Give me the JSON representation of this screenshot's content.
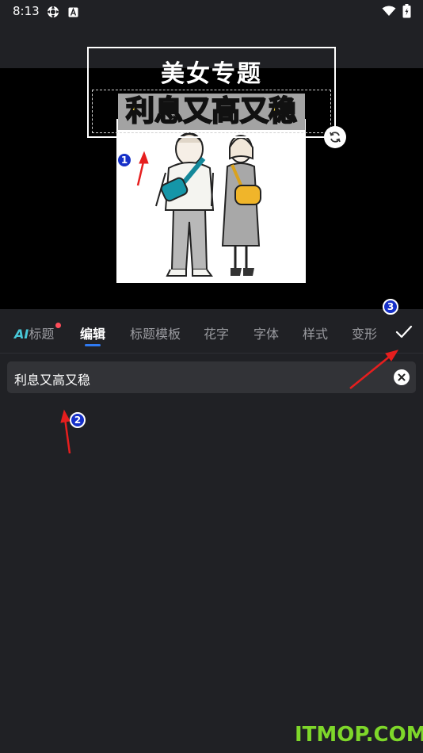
{
  "status_bar": {
    "time": "8:13",
    "icons": [
      "settings-icon",
      "a-icon",
      "wifi-icon",
      "battery-icon"
    ]
  },
  "preview": {
    "title_line1": "美女专题",
    "title_line2": "利息又高又稳"
  },
  "tabs": [
    {
      "label": "AI标题",
      "ai_prefix": "AI",
      "rest": "标题",
      "active": false
    },
    {
      "label": "编辑",
      "active": true
    },
    {
      "label": "标题模板",
      "active": false
    },
    {
      "label": "花字",
      "active": false
    },
    {
      "label": "字体",
      "active": false
    },
    {
      "label": "样式",
      "active": false
    },
    {
      "label": "变形",
      "active": false
    }
  ],
  "text_input": {
    "value": "利息又高又稳"
  },
  "annotations": {
    "badge_1": "1",
    "badge_2": "2",
    "badge_3": "3"
  },
  "watermark": "ITMOP.COM",
  "colors": {
    "accent": "#2f7af2",
    "title_yellow": "#ffe03a",
    "arrow_red": "#e61e1e",
    "badge_blue": "#1630c8",
    "watermark_green": "#7ed72a",
    "background": "#202125"
  }
}
